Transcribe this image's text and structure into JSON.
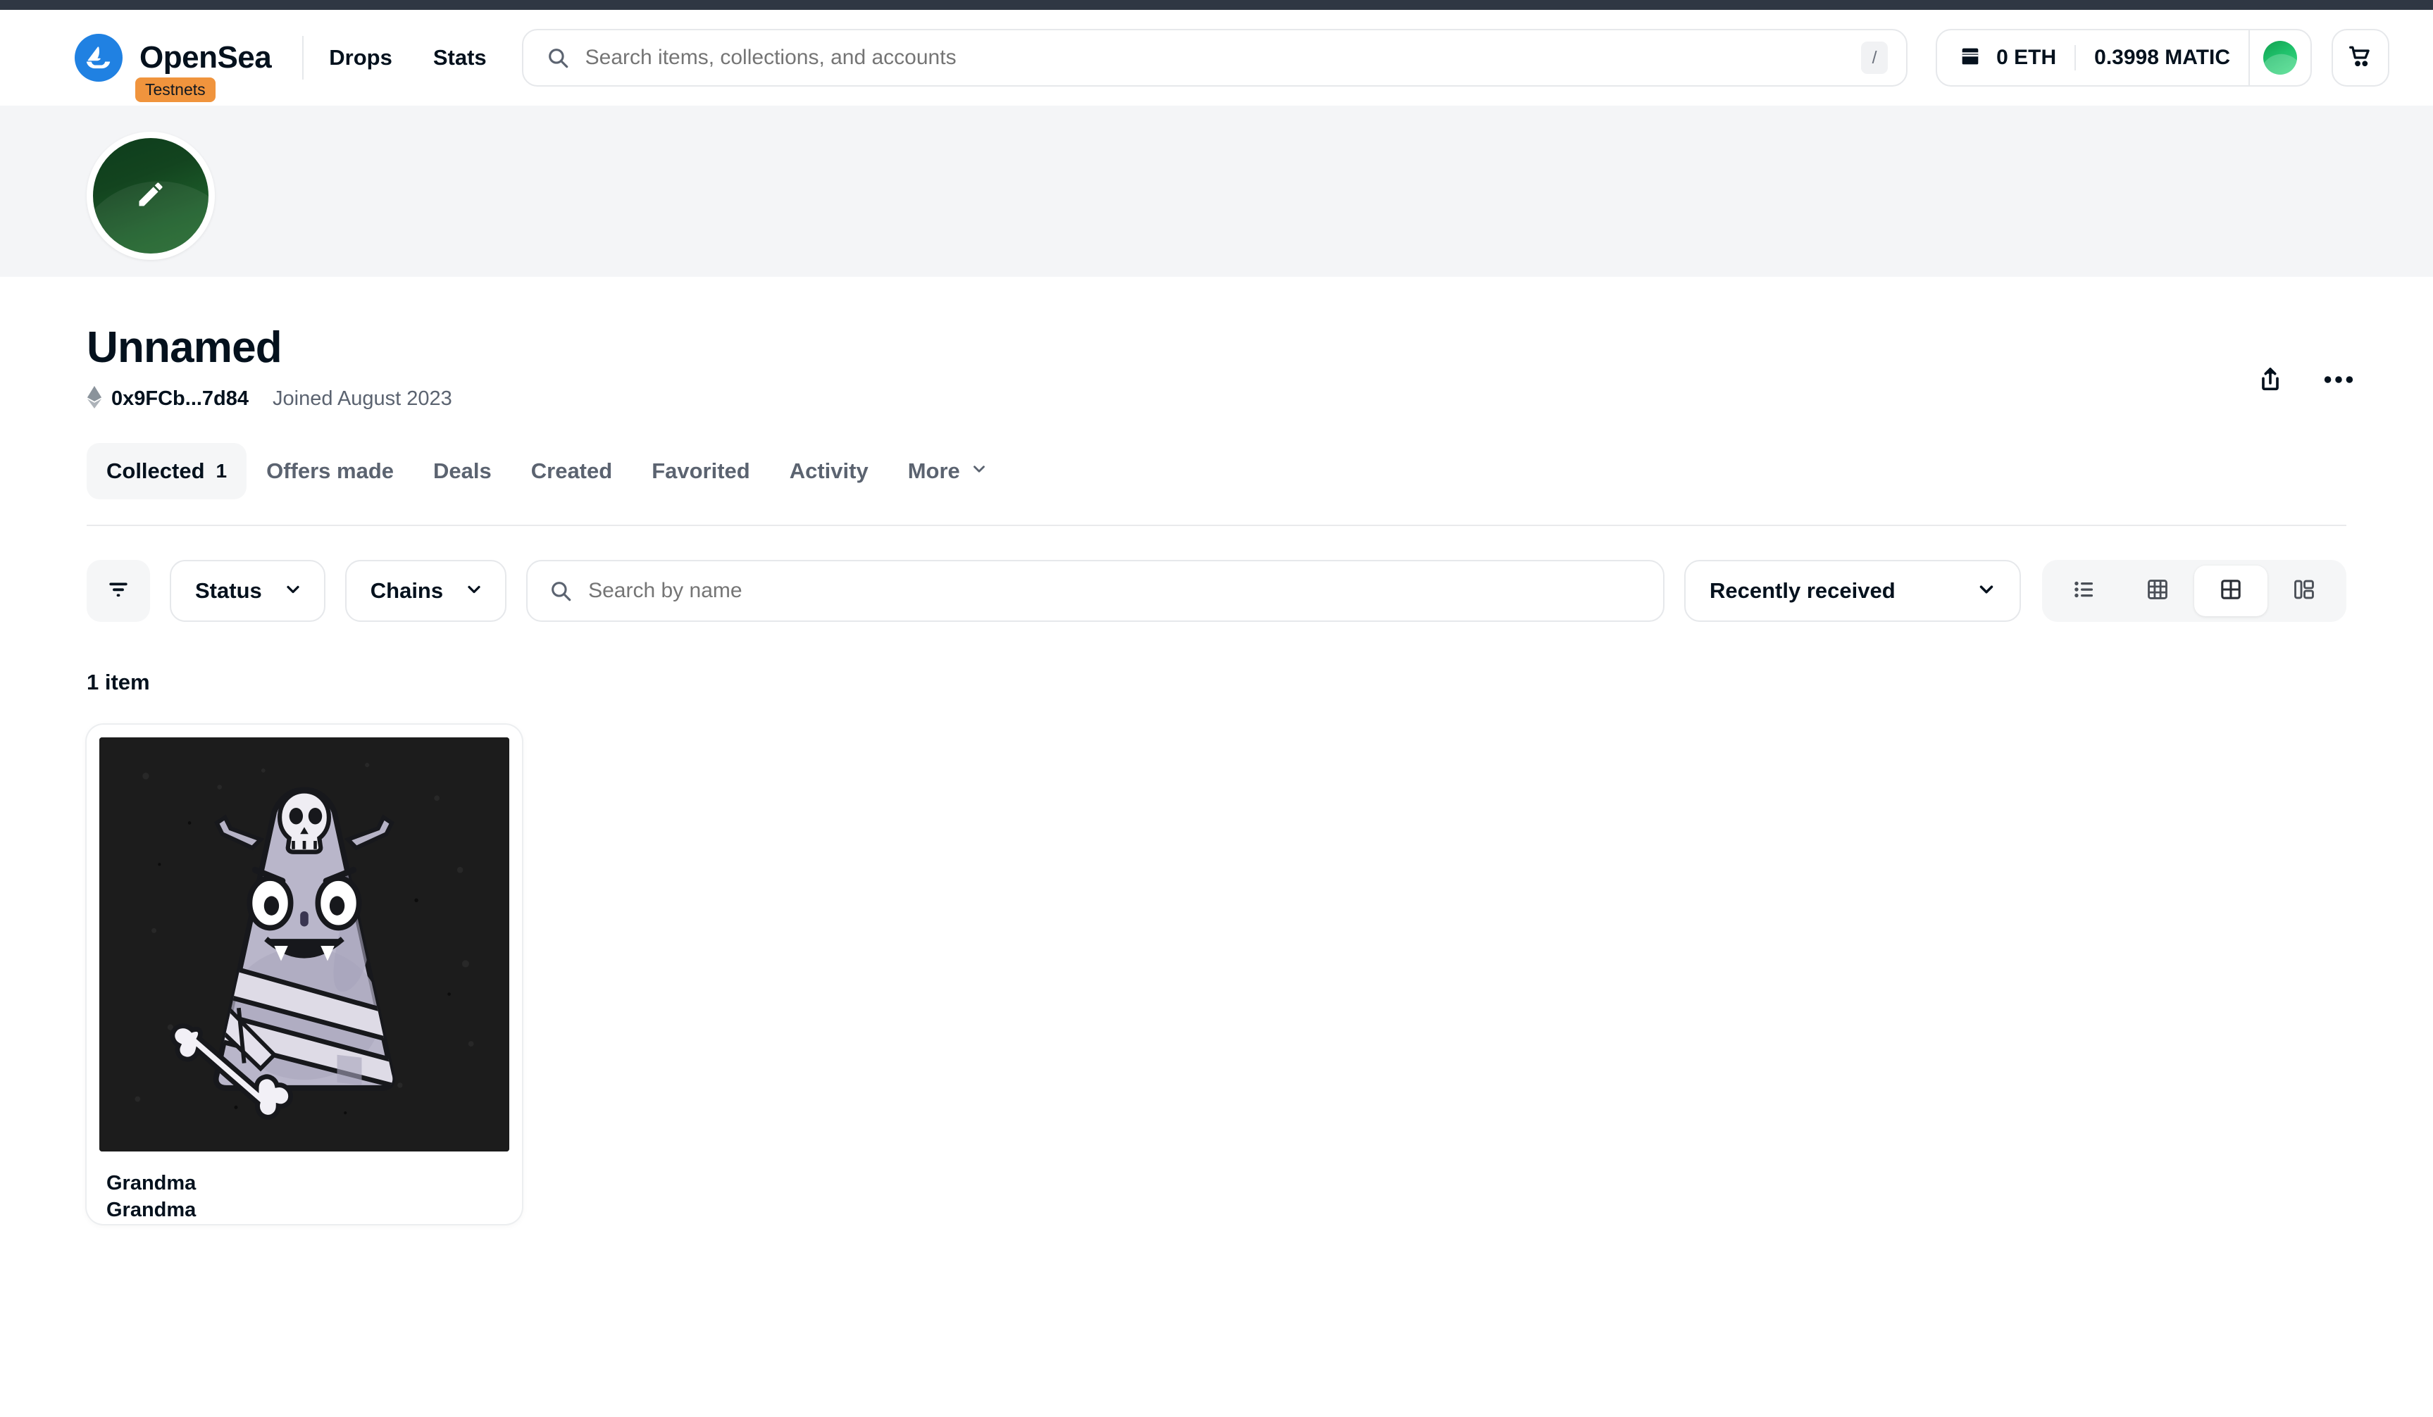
{
  "nav": {
    "brand_name": "OpenSea",
    "brand_logo_icon": "opensea-sailboat-icon",
    "testnet_badge": "Testnets",
    "links": [
      {
        "label": "Drops"
      },
      {
        "label": "Stats"
      }
    ],
    "search": {
      "placeholder": "Search items, collections, and accounts",
      "icon": "search-icon",
      "shortcut_key": "/"
    },
    "wallet": {
      "icon": "wallet-icon",
      "eth_balance": "0 ETH",
      "matic_balance": "0.3998 MATIC",
      "avatar_icon": "user-avatar-icon"
    },
    "cart_icon": "shopping-cart-icon"
  },
  "profile": {
    "avatar": {
      "edit_icon": "pencil-edit-icon",
      "gradient_start": "#0d3d1c",
      "gradient_end": "#256b30"
    },
    "name": "Unnamed",
    "chain_icon": "ethereum-icon",
    "address": "0x9FCb...7d84",
    "joined": "Joined August 2023",
    "share_icon": "share-icon",
    "more_icon": "more-horizontal-icon"
  },
  "tabs": [
    {
      "label": "Collected",
      "count": "1",
      "active": true
    },
    {
      "label": "Offers made",
      "count": "",
      "active": false
    },
    {
      "label": "Deals",
      "count": "",
      "active": false
    },
    {
      "label": "Created",
      "count": "",
      "active": false
    },
    {
      "label": "Favorited",
      "count": "",
      "active": false
    },
    {
      "label": "Activity",
      "count": "",
      "active": false
    },
    {
      "label": "More",
      "count": "",
      "active": false
    }
  ],
  "filters": {
    "filter_icon": "filter-lines-icon",
    "status_label": "Status",
    "chains_label": "Chains",
    "name_search_placeholder": "Search by name",
    "name_search_value": "",
    "name_search_icon": "search-icon",
    "sort_label": "Recently received",
    "views": [
      {
        "name": "list-view",
        "icon": "list-view-icon",
        "active": false
      },
      {
        "name": "dense-grid-view",
        "icon": "grid-3x3-icon",
        "active": false
      },
      {
        "name": "large-grid-view",
        "icon": "grid-2x2-icon",
        "active": true
      },
      {
        "name": "detail-view",
        "icon": "columns-layout-icon",
        "active": false
      }
    ]
  },
  "results": {
    "count_label": "1 item",
    "items": [
      {
        "collection": "Grandma",
        "name": "Grandma",
        "image_alt": "grey-monster-mummy-with-skull-and-bone",
        "image_bg": "#1c1c1c"
      }
    ]
  },
  "colors": {
    "brand_blue": "#2081e2",
    "badge_orange": "#f0943d",
    "text_primary": "#04111d",
    "text_secondary": "#5b6370",
    "border": "#e6e8eb",
    "surface_gray": "#f5f6f7",
    "banner_gray": "#f4f5f7"
  }
}
